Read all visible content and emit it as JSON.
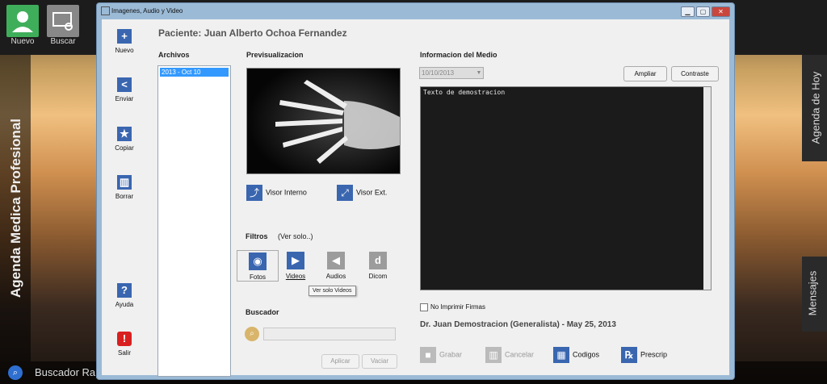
{
  "topbar": {
    "nuevo_label": "Nuevo",
    "buscar_label": "Buscar"
  },
  "left_banner": "Agenda Medica Profesional",
  "right_panels": {
    "agenda": "Agenda de Hoy",
    "mensajes": "Mensajes"
  },
  "bottom": {
    "buscador": "Buscador Rapi"
  },
  "window": {
    "title": "Imagenes, Audio y Video",
    "min": "▁",
    "max": "▢",
    "close": "✕"
  },
  "sidebar": [
    {
      "label": "Nuevo",
      "icon": "+"
    },
    {
      "label": "Enviar",
      "icon": "<"
    },
    {
      "label": "Copiar",
      "icon": "★"
    },
    {
      "label": "Borrar",
      "icon": "▥"
    },
    {
      "label": "Ayuda",
      "icon": "?"
    },
    {
      "label": "Salir",
      "icon": "!"
    }
  ],
  "patient": "Paciente: Juan Alberto Ochoa Fernandez",
  "archivos": {
    "title": "Archivos",
    "items": [
      "2013 - Oct 10"
    ]
  },
  "preview": {
    "title": "Previsualizacion",
    "visor_interno": "Visor Interno",
    "visor_ext": "Visor Ext."
  },
  "filtros": {
    "title": "Filtros",
    "subtitle": "(Ver solo..)",
    "options": [
      "Fotos",
      "Videos",
      "Audios",
      "Dicom"
    ],
    "tooltip": "Ver solo Videos"
  },
  "buscador": {
    "title": "Buscador",
    "aplicar": "Aplicar",
    "vaciar": "Vaciar"
  },
  "info": {
    "title": "Informacion del Medio",
    "date": "10/10/2013",
    "ampliar": "Ampliar",
    "contraste": "Contraste",
    "text": "Texto de demostracion",
    "no_imprimir": "No Imprimir Firmas",
    "doctor": "Dr. Juan Demostracion (Generalista) - May 25, 2013"
  },
  "actions": {
    "grabar": "Grabar",
    "cancelar": "Cancelar",
    "codigos": "Codigos",
    "prescrip": "Prescrip"
  },
  "colors": {
    "accent": "#3a66b0",
    "danger": "#d92020",
    "nuevo_green": "#3fae5a"
  }
}
